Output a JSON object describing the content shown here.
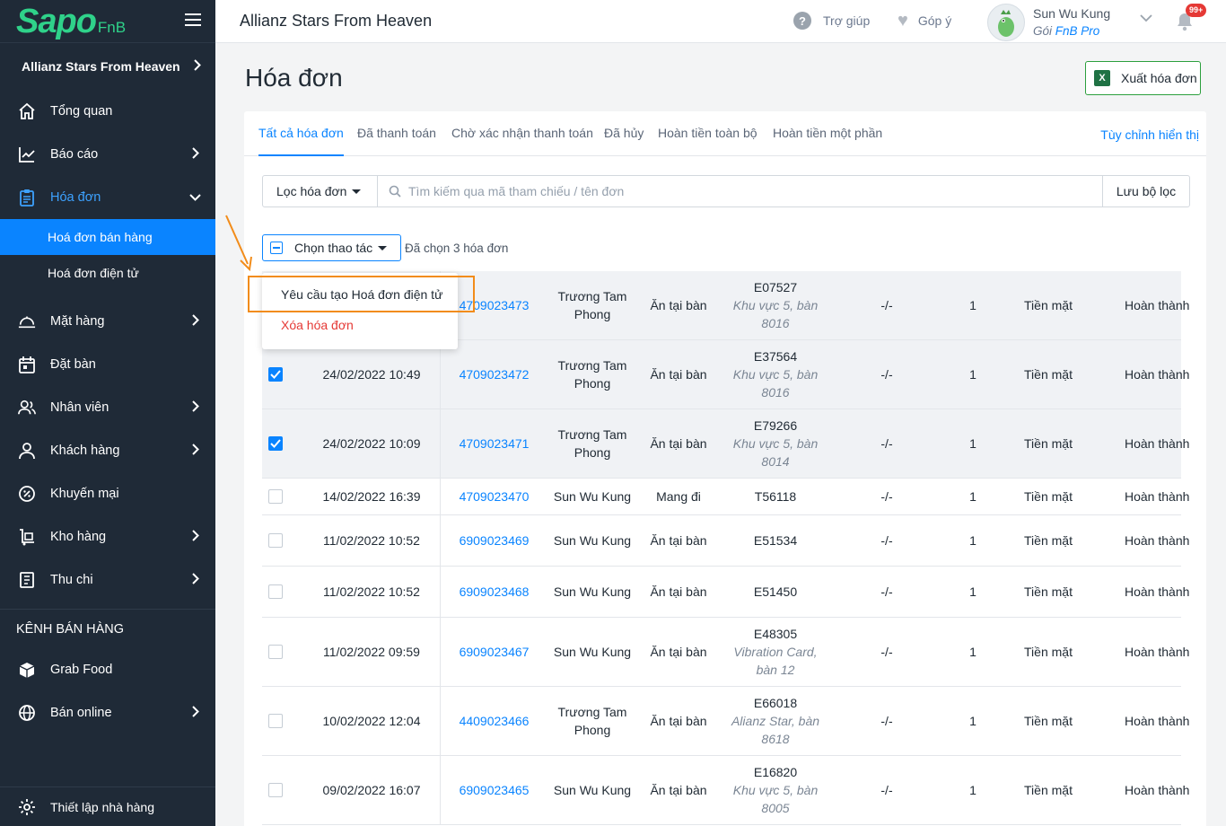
{
  "sidebar": {
    "logo_main": "Sapo",
    "logo_sub": "FnB",
    "store": "Allianz Stars From Heaven",
    "items": [
      {
        "label": "Tổng quan"
      },
      {
        "label": "Báo cáo"
      },
      {
        "label": "Hóa đơn"
      },
      {
        "label": "Mặt hàng"
      },
      {
        "label": "Đặt bàn"
      },
      {
        "label": "Nhân viên"
      },
      {
        "label": "Khách hàng"
      },
      {
        "label": "Khuyến mại"
      },
      {
        "label": "Kho hàng"
      },
      {
        "label": "Thu chi"
      }
    ],
    "sub_items": [
      {
        "label": "Hoá đơn bán hàng"
      },
      {
        "label": "Hoá đơn điện tử"
      }
    ],
    "channel_section": "KÊNH BÁN HÀNG",
    "channels": [
      {
        "label": "Grab Food"
      },
      {
        "label": "Bán online"
      }
    ],
    "footer": "Thiết lập nhà hàng"
  },
  "header": {
    "store_name": "Allianz Stars From Heaven",
    "help": "Trợ giúp",
    "feedback": "Góp ý",
    "user_name": "Sun Wu Kung",
    "plan_prefix": "Gói",
    "plan_name": "FnB Pro",
    "notification_count": "99+"
  },
  "page": {
    "title": "Hóa đơn",
    "export_label": "Xuất hóa đơn"
  },
  "tabs": [
    {
      "label": "Tất cả hóa đơn"
    },
    {
      "label": "Đã thanh toán"
    },
    {
      "label": "Chờ xác nhận thanh toán"
    },
    {
      "label": "Đã hủy"
    },
    {
      "label": "Hoàn tiền toàn bộ"
    },
    {
      "label": "Hoàn tiền một phần"
    }
  ],
  "customize_label": "Tùy chỉnh hiển thị",
  "filter": {
    "select_label": "Lọc hóa đơn",
    "search_placeholder": "Tìm kiếm qua mã tham chiếu / tên đơn",
    "save_label": "Lưu bộ lọc"
  },
  "bulk": {
    "select_label": "Chọn thao tác",
    "selected_text": "Đã chọn 3 hóa đơn"
  },
  "dropdown": {
    "option_1": "Yêu cầu tạo Hoá đơn điện tử",
    "option_2": "Xóa hóa đơn"
  },
  "rows": [
    {
      "date": "",
      "code": "4709023473",
      "staff": [
        "Trương Tam",
        "Phong"
      ],
      "type": "Ăn tại bàn",
      "table": [
        "E07527"
      ],
      "area": [
        "Khu vực 5, bàn",
        "8016"
      ],
      "dash": "-/-",
      "qty": "1",
      "payment": "Tiền mặt",
      "status": "Hoàn thành"
    },
    {
      "date": "24/02/2022 10:49",
      "code": "4709023472",
      "staff": [
        "Trương Tam",
        "Phong"
      ],
      "type": "Ăn tại bàn",
      "table": [
        "E37564"
      ],
      "area": [
        "Khu vực 5, bàn",
        "8016"
      ],
      "dash": "-/-",
      "qty": "1",
      "payment": "Tiền mặt",
      "status": "Hoàn thành"
    },
    {
      "date": "24/02/2022 10:09",
      "code": "4709023471",
      "staff": [
        "Trương Tam",
        "Phong"
      ],
      "type": "Ăn tại bàn",
      "table": [
        "E79266"
      ],
      "area": [
        "Khu vực 5, bàn",
        "8014"
      ],
      "dash": "-/-",
      "qty": "1",
      "payment": "Tiền mặt",
      "status": "Hoàn thành"
    },
    {
      "date": "14/02/2022 16:39",
      "code": "4709023470",
      "staff": [
        "Sun Wu Kung"
      ],
      "type": "Mang đi",
      "table": [
        "T56118"
      ],
      "area": [],
      "dash": "-/-",
      "qty": "1",
      "payment": "Tiền mặt",
      "status": "Hoàn thành"
    },
    {
      "date": "11/02/2022 10:52",
      "code": "6909023469",
      "staff": [
        "Sun Wu Kung"
      ],
      "type": "Ăn tại bàn",
      "table": [
        "E51534"
      ],
      "area": [],
      "dash": "-/-",
      "qty": "1",
      "payment": "Tiền mặt",
      "status": "Hoàn thành"
    },
    {
      "date": "11/02/2022 10:52",
      "code": "6909023468",
      "staff": [
        "Sun Wu Kung"
      ],
      "type": "Ăn tại bàn",
      "table": [
        "E51450"
      ],
      "area": [],
      "dash": "-/-",
      "qty": "1",
      "payment": "Tiền mặt",
      "status": "Hoàn thành"
    },
    {
      "date": "11/02/2022 09:59",
      "code": "6909023467",
      "staff": [
        "Sun Wu Kung"
      ],
      "type": "Ăn tại bàn",
      "table": [
        "E48305"
      ],
      "area": [
        "Vibration Card,",
        "bàn 12"
      ],
      "dash": "-/-",
      "qty": "1",
      "payment": "Tiền mặt",
      "status": "Hoàn thành"
    },
    {
      "date": "10/02/2022 12:04",
      "code": "4409023466",
      "staff": [
        "Trương Tam",
        "Phong"
      ],
      "type": "Ăn tại bàn",
      "table": [
        "E66018"
      ],
      "area": [
        "Alianz Star, bàn",
        "8618"
      ],
      "dash": "-/-",
      "qty": "1",
      "payment": "Tiền mặt",
      "status": "Hoàn thành"
    },
    {
      "date": "09/02/2022 16:07",
      "code": "6909023465",
      "staff": [
        "Sun Wu Kung"
      ],
      "type": "Ăn tại bàn",
      "table": [
        "E16820"
      ],
      "area": [
        "Khu vực 5, bàn",
        "8005"
      ],
      "dash": "-/-",
      "qty": "1",
      "payment": "Tiền mặt",
      "status": "Hoàn thành"
    }
  ],
  "colors": {
    "sidebar_bg": "#1f2a37",
    "accent": "#0a84ff",
    "brand": "#2fd28a",
    "highlight": "#f28c1a",
    "danger": "#e53935"
  }
}
